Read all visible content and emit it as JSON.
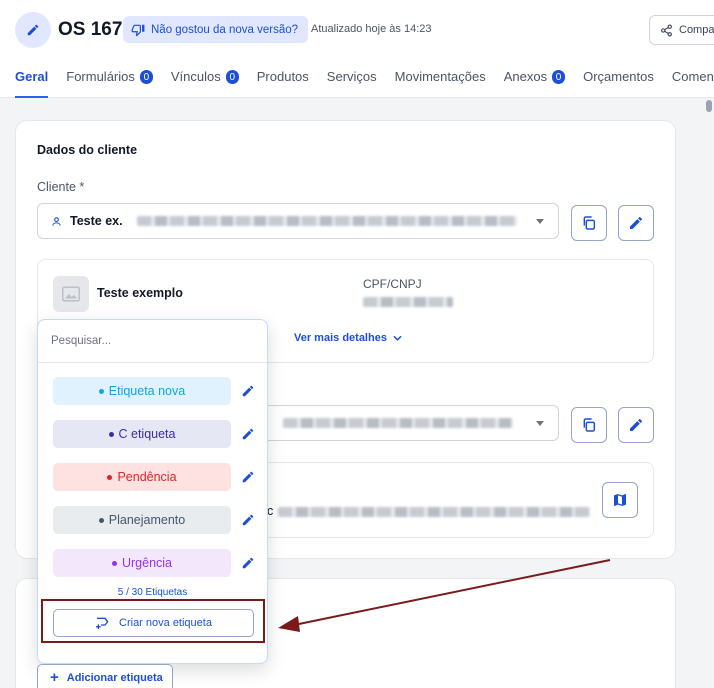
{
  "header": {
    "title": "OS 167",
    "feedback_label": "Não gostou da nova versão?",
    "updated_text": "Atualizado hoje às 14:23",
    "share_label": "Compa"
  },
  "tabs": [
    {
      "label": "Geral",
      "active": true
    },
    {
      "label": "Formulários",
      "badge": "0"
    },
    {
      "label": "Vínculos",
      "badge": "0"
    },
    {
      "label": "Produtos"
    },
    {
      "label": "Serviços"
    },
    {
      "label": "Movimentações"
    },
    {
      "label": "Anexos",
      "badge": "0"
    },
    {
      "label": "Orçamentos"
    },
    {
      "label": "Comentá"
    }
  ],
  "client_section": {
    "title": "Dados do cliente",
    "client_label": "Cliente *",
    "client_value": "Teste ex.",
    "client_card_name": "Teste exemplo",
    "cpf_label": "CPF/CNPJ",
    "more_details": "Ver mais detalhes",
    "address_prefix": "c"
  },
  "tag_dropdown": {
    "search_placeholder": "Pesquisar...",
    "tags": [
      {
        "label": "Etiqueta nova",
        "color": "#0ea5e9",
        "bg": "#e0f2fe"
      },
      {
        "label": "C etiqueta",
        "color": "#3730a3",
        "bg": "#e5e7f5"
      },
      {
        "label": "Pendência",
        "color": "#dc2626",
        "bg": "#fee2e2"
      },
      {
        "label": "Planejamento",
        "color": "#475569",
        "bg": "#e9ecef"
      },
      {
        "label": "Urgência",
        "color": "#9333ea",
        "bg": "#f3e8fb"
      }
    ],
    "count_text": "5 / 30 Etiquetas",
    "create_label": "Criar nova etiqueta"
  },
  "add_tag_label": "Adicionar etiqueta",
  "colors": {
    "primary": "#1d4ed8",
    "annotation": "#7a1a1a"
  }
}
